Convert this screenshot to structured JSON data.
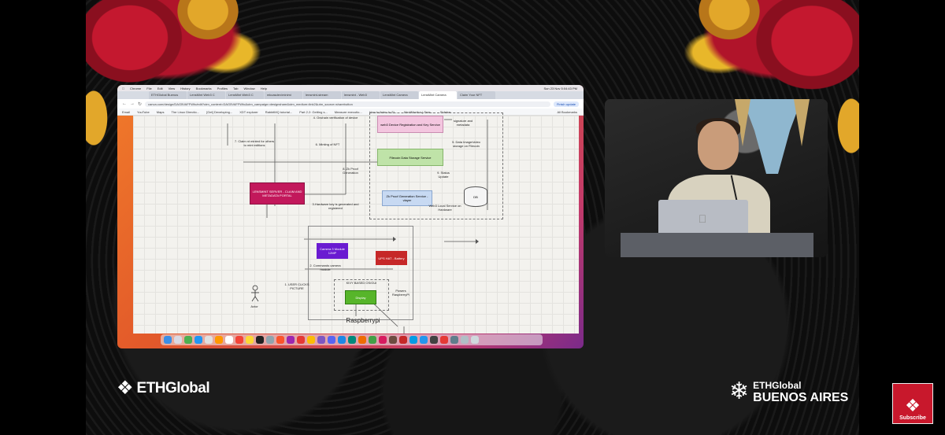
{
  "colors": {
    "accent_red": "#c8182c",
    "gold": "#e2a72a"
  },
  "mac_menu": [
    "Chrome",
    "File",
    "Edit",
    "View",
    "History",
    "Bookmarks",
    "Profiles",
    "Tab",
    "Window",
    "Help"
  ],
  "mac_clock": "Sun 23 Nov 5:04:43 PM",
  "browser_tabs": [
    {
      "label": "ETHGlobal Buenos"
    },
    {
      "label": "LensMint Web3 C"
    },
    {
      "label": "LensMint Web3 C"
    },
    {
      "label": "mkcasdev/minimi"
    },
    {
      "label": "lensmint-stream"
    },
    {
      "label": "lensmint - Web3"
    },
    {
      "label": "LensMint Camera"
    },
    {
      "label": "LensMint Camera",
      "active": true
    },
    {
      "label": "Claim Your NFT"
    }
  ],
  "url": "canva.com/design/DAG5VAFFWfo/edit?utm_content=DAG5VAFFWfo&utm_campaign=designshare&utm_medium=link2&utm_source=sharebutton",
  "finish_update": "Finish update",
  "bookmarks": [
    "Email",
    "YouTube",
    "Maps",
    "The Linux Directio...",
    "[Get] Developing...",
    "XDT explorer",
    "RabbitMQ tutorial...",
    "Part 2.2: Getting s...",
    "Measure executio...",
    "How to listen to Si...",
    "MediMonitor | Sear...",
    "Sidebar"
  ],
  "all_bookmarks": "All Bookmarks",
  "diagram": {
    "n_device_reg": "web3 Device Registration and Key Service",
    "n_filecoin": "Filecoin Data Storage Service",
    "n_zk": "Zk Proof Generation Service - vlayer",
    "n_db": "DB",
    "n_server": "LENSMINT SERVER - CLAIM AND METADATA PORTAL",
    "n_camera": "Camera 3 Module 12MP",
    "n_ups": "UPS HAT - Battery",
    "n_display": "Display",
    "l_onchain": "4. Onchain verification of device",
    "l_signature": "signature and metadata",
    "l_claim": "7. Claim nt minted for others to mint editions",
    "l_minting": "6. Minting of NFT",
    "l_data_image": "5. Data Image/video storage on Filecoin",
    "l_zk_gen": "8. Zk Proof Generation",
    "l_status": "9. Status Update",
    "l_hardware_key": "3.Hardware key is generated and registered",
    "l_local_service": "Web3 Local Service on Hardware",
    "l_commands": "2. Commands camera module",
    "l_kivy": "KIVY BASED OS/GUI",
    "l_user_clicks": "1. USER CLICKS PICTURE",
    "l_actor": "Actor",
    "l_powers": "Powers RaspberryPi",
    "l_raspberry": "Raspberrypi"
  },
  "logos": {
    "left_text": "ETHGlobal",
    "right_top": "ETHGlobal",
    "right_bottom": "BUENOS AIRES",
    "subscribe": "Subscribe"
  }
}
